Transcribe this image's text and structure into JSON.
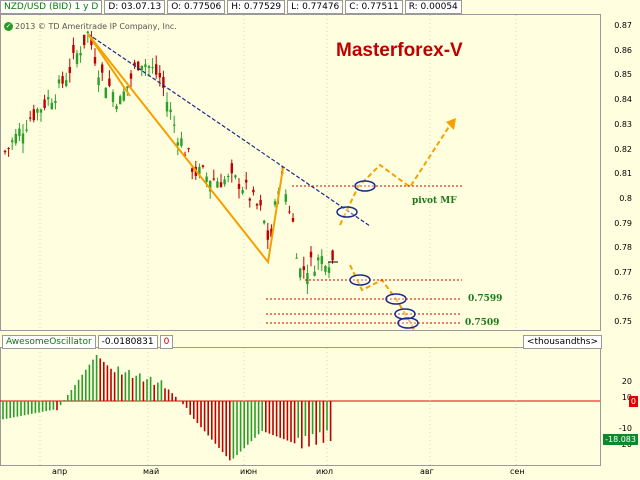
{
  "header": {
    "symbol": "NZD/USD (BID) 1 y D",
    "date": "D: 03.07.13",
    "open": "O: 0.77506",
    "high": "H: 0.77529",
    "low": "L: 0.77476",
    "close": "C: 0.77511",
    "range": "R: 0.00054"
  },
  "watermark": "2013 © TD Ameritrade IP Company, Inc.",
  "brand": "Masterforex-V",
  "annotations": {
    "pivot": "pivot MF",
    "level1": "0.7599",
    "level2": "0.7509"
  },
  "price_axis": [
    "0.87",
    "0.86",
    "0.85",
    "0.84",
    "0.83",
    "0.82",
    "0.81",
    "0.8",
    "0.79",
    "0.78",
    "0.77",
    "0.76",
    "0.75"
  ],
  "oscillator": {
    "name": "AwesomeOscillator",
    "value": "-0.0180831",
    "zero": "0",
    "units": "<thousandths>",
    "axis": [
      "20",
      "10",
      "0",
      "-10",
      "-20"
    ],
    "badge_zero": "0",
    "badge_value": "-18.083"
  },
  "months": [
    "апр",
    "май",
    "июн",
    "июл",
    "авг",
    "сен"
  ],
  "colors": {
    "up": "#2aa02a",
    "down": "#c00000",
    "background": "#ffffe0",
    "orange": "#f5a000",
    "navy": "#1a2a8a"
  }
}
